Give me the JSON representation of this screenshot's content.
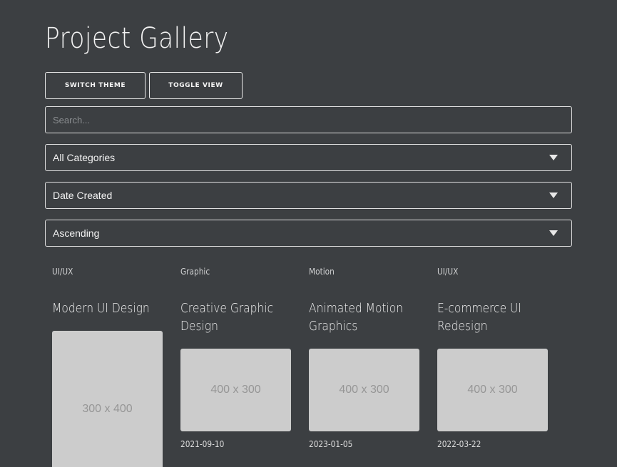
{
  "header": {
    "title": "Project Gallery"
  },
  "toolbar": {
    "switch_theme_label": "SWITCH THEME",
    "toggle_view_label": "TOGGLE VIEW"
  },
  "search": {
    "placeholder": "Search...",
    "value": ""
  },
  "filters": {
    "category": "All Categories",
    "sort_by": "Date Created",
    "order": "Ascending"
  },
  "projects": [
    {
      "category": "UI/UX",
      "title": "Modern UI Design",
      "image_label": "300 x 400",
      "date": ""
    },
    {
      "category": "Graphic",
      "title": "Creative Graphic Design",
      "image_label": "400 x 300",
      "date": "2021-09-10"
    },
    {
      "category": "Motion",
      "title": "Animated Motion Graphics",
      "image_label": "400 x 300",
      "date": "2023-01-05"
    },
    {
      "category": "UI/UX",
      "title": "E-commerce UI Redesign",
      "image_label": "400 x 300",
      "date": "2022-03-22"
    }
  ],
  "colors": {
    "background": "#3c3f42",
    "border": "#e0e0e0",
    "placeholder_image": "#cccccc",
    "placeholder_text": "#969696"
  },
  "icons": {
    "dropdown": "caret-down-icon"
  }
}
